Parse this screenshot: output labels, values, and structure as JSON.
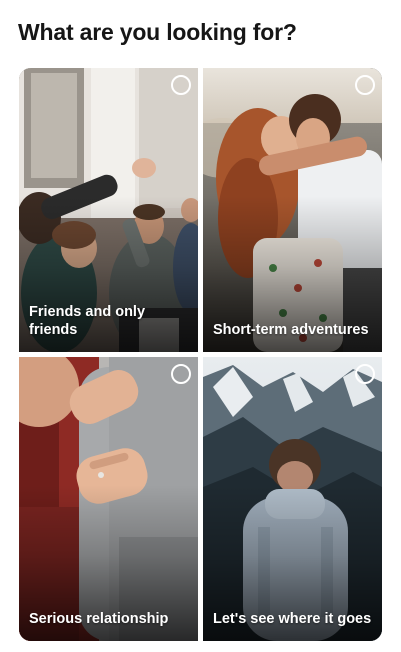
{
  "header": {
    "title": "What are you looking for?"
  },
  "options": [
    {
      "label": "Friends and only friends",
      "photo_icon": "group-of-friends-high-five-photo",
      "selected": false
    },
    {
      "label": "Short-term adventures",
      "photo_icon": "couple-embracing-at-beach-photo",
      "selected": false
    },
    {
      "label": "Serious relationship",
      "photo_icon": "couple-holding-hands-photo",
      "selected": false
    },
    {
      "label": "Let's see where it goes",
      "photo_icon": "person-facing-mountains-photo",
      "selected": false
    }
  ],
  "colors": {
    "text": "#161616",
    "background": "#ffffff",
    "radio": "#ffffff"
  }
}
